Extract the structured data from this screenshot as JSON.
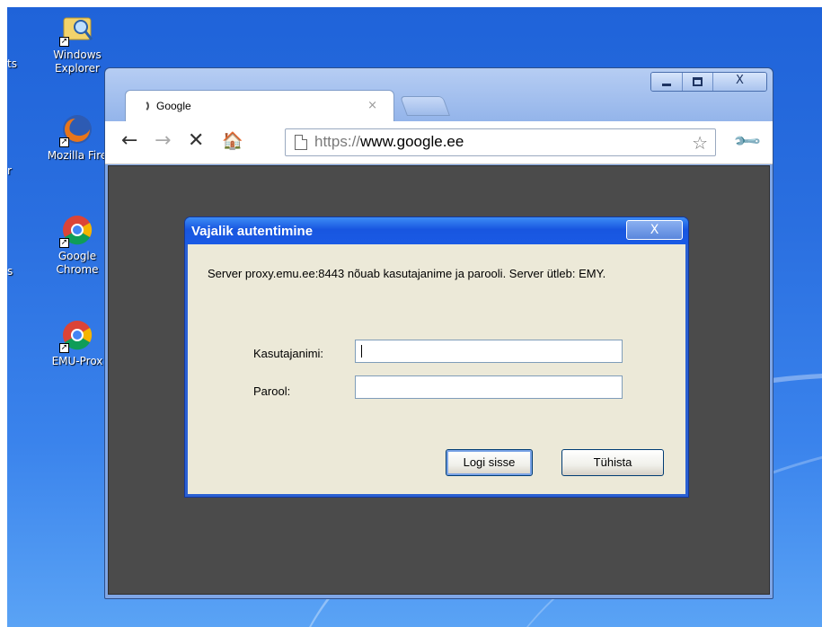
{
  "desktop": {
    "icons": [
      {
        "label": "Windows Explorer",
        "icon": "windows-explorer-icon"
      },
      {
        "label": "Mozilla Fire",
        "icon": "firefox-icon"
      },
      {
        "label": "Google Chrome",
        "icon": "chrome-icon"
      },
      {
        "label": "EMU-Prox",
        "icon": "chrome-icon"
      }
    ],
    "cut_labels": [
      "ts",
      "r",
      "s"
    ]
  },
  "browser": {
    "tab": {
      "title": "Google",
      "close": "×"
    },
    "nav": {
      "back": "←",
      "forward": "→",
      "stop": "✕",
      "home": "🏠"
    },
    "omnibox": {
      "scheme": "https://",
      "host": "www.google.ee"
    },
    "window_close": "X",
    "star": "☆",
    "wrench": "🔧"
  },
  "dialog": {
    "title": "Vajalik autentimine",
    "close": "X",
    "message": "Server proxy.emu.ee:8443 nõuab kasutajanime ja parooli. Server ütleb: EMY.",
    "username_label": "Kasutajanimi:",
    "username_value": "",
    "password_label": "Parool:",
    "password_value": "",
    "login_button": "Logi sisse",
    "cancel_button": "Tühista"
  },
  "colors": {
    "dialog_title": "#1a5ae5",
    "dialog_bg": "#ece9d8",
    "content_bg": "#4b4b4b"
  }
}
